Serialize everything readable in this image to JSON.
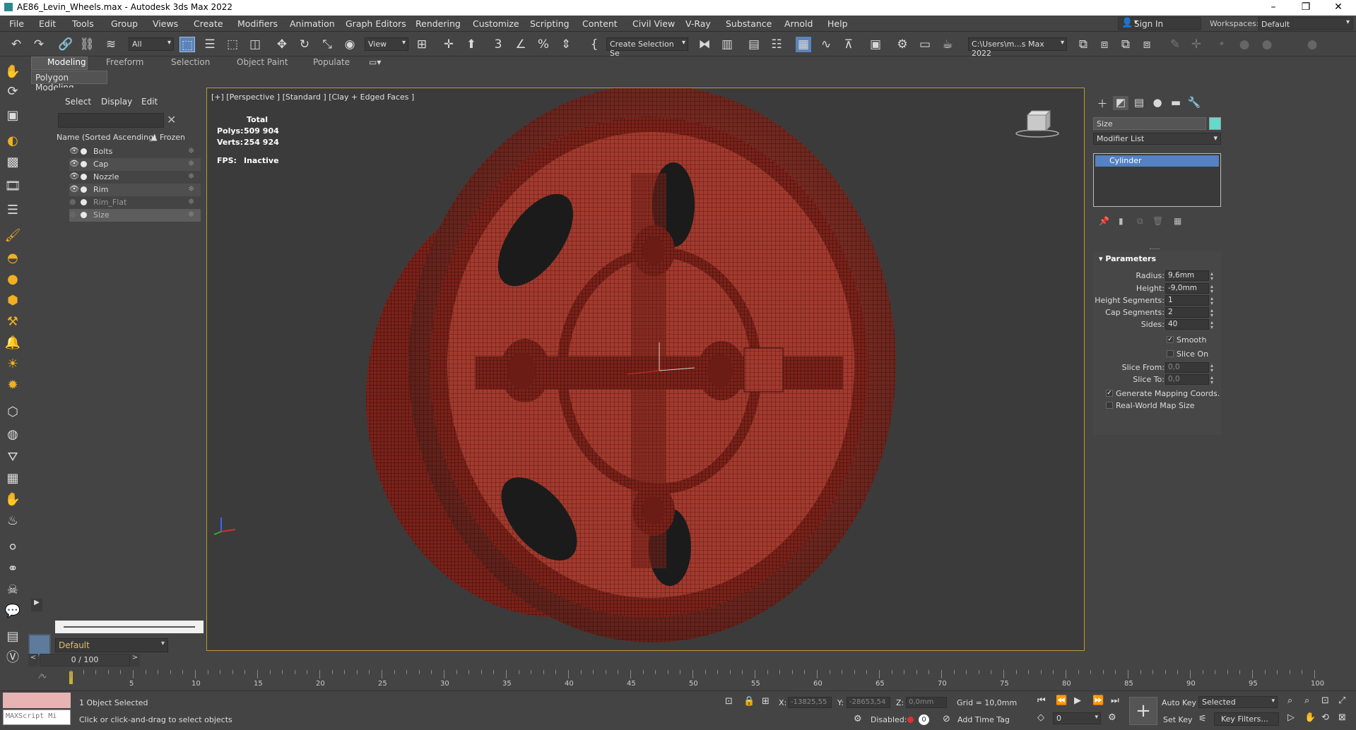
{
  "window": {
    "title": "AE86_Levin_Wheels.max - Autodesk 3ds Max 2022",
    "minimize": "–",
    "maximize": "❐",
    "close": "✕"
  },
  "menu": [
    "File",
    "Edit",
    "Tools",
    "Group",
    "Views",
    "Create",
    "Modifiers",
    "Animation",
    "Graph Editors",
    "Rendering",
    "Customize",
    "Scripting",
    "Content",
    "Civil View",
    "V-Ray",
    "Substance",
    "Arnold",
    "Help"
  ],
  "sign_in": "Sign In",
  "workspaces": {
    "label": "Workspaces:",
    "value": "Default"
  },
  "toolbar": {
    "filter": "All",
    "ref_coord": "View",
    "selection_set": "Create Selection Se",
    "project_path": "C:\\Users\\m...s Max 2022"
  },
  "ribbon": {
    "tabs": [
      "Modeling",
      "Freeform",
      "Selection",
      "Object Paint",
      "Populate"
    ],
    "sub": "Polygon Modeling"
  },
  "explorer": {
    "tabs": [
      "Select",
      "Display",
      "Edit"
    ],
    "header_name": "Name (Sorted Ascending)",
    "header_frozen": "▲ Frozen",
    "rows": [
      {
        "name": "Bolts",
        "visible": true
      },
      {
        "name": "Cap",
        "visible": true
      },
      {
        "name": "Nozzle",
        "visible": true
      },
      {
        "name": "Rim",
        "visible": true
      },
      {
        "name": "Rim_Flat",
        "visible": false
      },
      {
        "name": "Size",
        "visible": false
      }
    ],
    "layer": "Default"
  },
  "viewport": {
    "label": "[+] [Perspective ] [Standard ] [Clay + Edged Faces ]",
    "stats_header": "Total",
    "polys_label": "Polys:",
    "polys": "509 904",
    "verts_label": "Verts:",
    "verts": "254 924",
    "fps_label": "FPS:",
    "fps": "Inactive"
  },
  "command_panel": {
    "object_name": "Size",
    "object_color": "#66d9c8",
    "modifier_list": "Modifier List",
    "stack_item": "Cylinder",
    "params_title": "Parameters",
    "params": [
      {
        "label": "Radius:",
        "value": "9,6mm"
      },
      {
        "label": "Height:",
        "value": "-9,0mm"
      },
      {
        "label": "Height Segments:",
        "value": "1"
      },
      {
        "label": "Cap Segments:",
        "value": "2"
      },
      {
        "label": "Sides:",
        "value": "40"
      }
    ],
    "smooth": "Smooth",
    "slice_on": "Slice On",
    "slice_from": {
      "label": "Slice From:",
      "value": "0,0"
    },
    "slice_to": {
      "label": "Slice To:",
      "value": "0,0"
    },
    "gen_mapping": "Generate Mapping Coords.",
    "real_world": "Real-World Map Size"
  },
  "timeline": {
    "slider": "0 / 100",
    "ticks": [
      "5",
      "10",
      "15",
      "20",
      "25",
      "30",
      "35",
      "40",
      "45",
      "50",
      "55",
      "60",
      "65",
      "70",
      "75",
      "80",
      "85",
      "90",
      "95",
      "100"
    ]
  },
  "status": {
    "maxscript": "MAXScript Mi",
    "selection": "1 Object Selected",
    "prompt": "Click or click-and-drag to select objects",
    "x_label": "X:",
    "x": "-13825,55",
    "y_label": "Y:",
    "y": "-28653,54",
    "z_label": "Z:",
    "z": "0,0mm",
    "grid": "Grid = 10,0mm",
    "disabled": "Disabled:",
    "add_time_tag": "Add Time Tag",
    "auto_key": "Auto Key",
    "selected": "Selected",
    "set_key": "Set Key",
    "key_filters": "Key Filters...",
    "frame": "0"
  }
}
